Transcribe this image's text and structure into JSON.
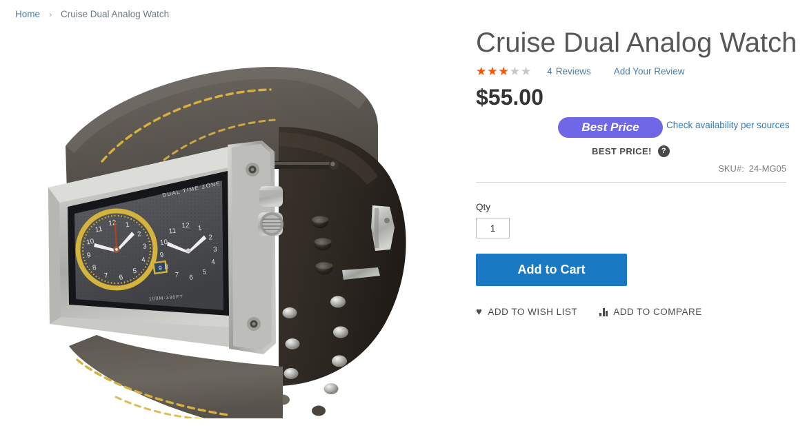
{
  "breadcrumb": {
    "home_label": "Home",
    "separator": "›",
    "current_label": "Cruise Dual Analog Watch"
  },
  "gallery": {
    "image_alt": "Cruise Dual Analog Watch - silver rectangular case with dual time zone dial on dark gray leather cuff strap with yellow stitching and metal studs",
    "dial_text_top": "DUAL TIME ZONE",
    "dial_text_bottom": "100M-330FT"
  },
  "product": {
    "title": "Cruise Dual Analog Watch",
    "rating_stars_filled": 3,
    "rating_stars_total": 5,
    "star_glyph": "★",
    "review_count": "4",
    "reviews_label": "Reviews",
    "add_review_label": "Add Your Review",
    "price": "$55.00",
    "best_price_badge": "Best Price",
    "sources_link": "Check availability per sources",
    "best_price_note": "BEST PRICE!",
    "help_glyph": "?",
    "sku_label": "SKU#:",
    "sku_value": "24-MG05",
    "qty_label": "Qty",
    "qty_value": "1",
    "add_to_cart_label": "Add to Cart",
    "wishlist_label": "ADD TO WISH LIST",
    "compare_label": "ADD TO COMPARE",
    "heart_glyph": "♥"
  },
  "colors": {
    "accent_blue": "#1979c3",
    "link_blue": "#4a7ea8",
    "star_orange": "#ff5501",
    "star_gray": "#c7c7c7",
    "badge_purple": "#7067e6",
    "text_dark": "#333333"
  }
}
